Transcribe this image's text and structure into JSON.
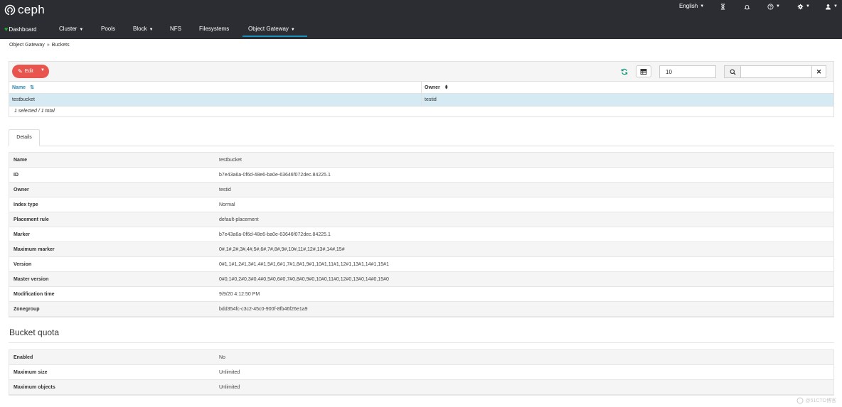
{
  "brand": {
    "name": "ceph"
  },
  "utility": {
    "language": "English",
    "icons": [
      "hourglass-icon",
      "bell-icon",
      "help-icon",
      "gear-icon",
      "user-icon"
    ]
  },
  "nav": {
    "dashboard": "Dashboard",
    "cluster": "Cluster",
    "pools": "Pools",
    "block": "Block",
    "nfs": "NFS",
    "filesystems": "Filesystems",
    "object_gateway": "Object Gateway"
  },
  "breadcrumb": {
    "parent": "Object Gateway",
    "separator": "»",
    "current": "Buckets"
  },
  "toolbar": {
    "edit_label": "Edit",
    "page_size": "10",
    "search_value": ""
  },
  "grid": {
    "columns": [
      "Name",
      "Owner"
    ],
    "rows": [
      {
        "name": "testbucket",
        "owner": "testid"
      }
    ],
    "footer": "1 selected / 1 total"
  },
  "tabs": {
    "details": "Details"
  },
  "details": [
    {
      "key": "Name",
      "value": "testbucket"
    },
    {
      "key": "ID",
      "value": "b7e43a6a-0f6d-48e6-ba0e-63646f072dec.84225.1"
    },
    {
      "key": "Owner",
      "value": "testid"
    },
    {
      "key": "Index type",
      "value": "Normal"
    },
    {
      "key": "Placement rule",
      "value": "default-placement"
    },
    {
      "key": "Marker",
      "value": "b7e43a6a-0f6d-48e6-ba0e-63646f072dec.84225.1"
    },
    {
      "key": "Maximum marker",
      "value": "0#,1#,2#,3#,4#,5#,6#,7#,8#,9#,10#,11#,12#,13#,14#,15#"
    },
    {
      "key": "Version",
      "value": "0#1,1#1,2#1,3#1,4#1,5#1,6#1,7#1,8#1,9#1,10#1,11#1,12#1,13#1,14#1,15#1"
    },
    {
      "key": "Master version",
      "value": "0#0,1#0,2#0,3#0,4#0,5#0,6#0,7#0,8#0,9#0,10#0,11#0,12#0,13#0,14#0,15#0"
    },
    {
      "key": "Modification time",
      "value": "9/9/20 4:12:50 PM"
    },
    {
      "key": "Zonegroup",
      "value": "bdd354fc-c3c2-45c0-900f-8fb46f26e1a9"
    }
  ],
  "quota": {
    "title": "Bucket quota",
    "rows": [
      {
        "key": "Enabled",
        "value": "No"
      },
      {
        "key": "Maximum size",
        "value": "Unlimited"
      },
      {
        "key": "Maximum objects",
        "value": "Unlimited"
      }
    ]
  },
  "watermark": {
    "text": "@51CTO博客"
  },
  "colors": {
    "header": "#2b2d32",
    "accent": "#1d8fbd",
    "edit": "#e8554e",
    "selected_row": "#d5eaf3"
  }
}
